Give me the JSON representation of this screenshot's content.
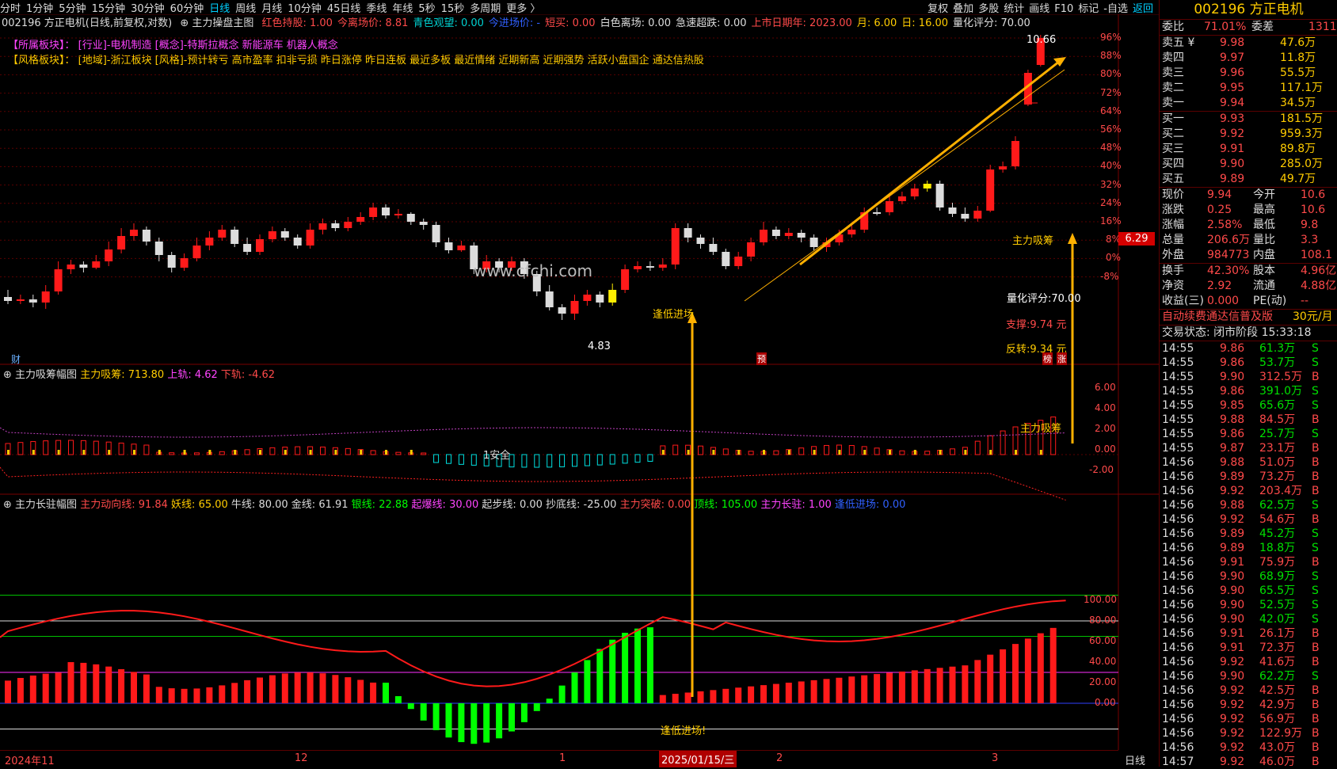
{
  "periods": [
    "分时",
    "1分钟",
    "5分钟",
    "15分钟",
    "30分钟",
    "60分钟",
    "日线",
    "周线",
    "月线",
    "10分钟",
    "45日线",
    "季线",
    "年线",
    "5秒",
    "15秒",
    "多周期",
    "更多 〉"
  ],
  "active_period": "日线",
  "tools": [
    "复权",
    "叠加",
    "多股",
    "统计",
    "画线",
    "F10",
    "标记",
    "-自选",
    "返回"
  ],
  "info": {
    "title": "002196 方正电机(日线,前复权,对数)",
    "indicator": "主力操盘主图",
    "items": [
      {
        "label": "红色持股: 1.00",
        "color": "#ff4a4a"
      },
      {
        "label": "今离场价: 8.81",
        "color": "#ff4a4a"
      },
      {
        "label": "青色观望: 0.00",
        "color": "#00d0d0"
      },
      {
        "label": "今进场价: -",
        "color": "#3060ff"
      },
      {
        "label": "短买: 0.00",
        "color": "#ff4a4a"
      },
      {
        "label": "白色离场: 0.00",
        "color": "#dddddd"
      },
      {
        "label": "急速超跌: 0.00",
        "color": "#dddddd"
      },
      {
        "label": "上市日期年: 2023.00",
        "color": "#ff4a4a"
      },
      {
        "label": "月: 6.00",
        "color": "#ffcc00"
      },
      {
        "label": "日: 16.00",
        "color": "#ffcc00"
      },
      {
        "label": "量化评分: 70.00",
        "color": "#dddddd"
      }
    ]
  },
  "sector": {
    "label1": "【所属板块】：",
    "value1": "[行业]-电机制造 [概念]-特斯拉概念 新能源车 机器人概念",
    "label2": "【风格板块】：",
    "value2": "[地域]-浙江板块 [风格]-预计转亏 高市盈率 扣非亏损 昨日涨停 昨日连板 最近多板 最近情绪 近期新高 近期强势 活跃小盘国企 通达信热股"
  },
  "main_axis": [
    "96%",
    "88%",
    "80%",
    "72%",
    "64%",
    "56%",
    "48%",
    "40%",
    "32%",
    "24%",
    "16%",
    "8%",
    "0%",
    "-8%"
  ],
  "price_tag": "6.29",
  "annotations": {
    "high": "10.66",
    "low": "4.83",
    "entry": "逢低进场",
    "accum": "主力吸筹",
    "score": "量化评分:70.00",
    "support": "支撑:9.74 元",
    "reverse": "反转:9.34 元",
    "watermark": "www.cfchi.com",
    "cai": "财",
    "yu": "预",
    "bang": "榜",
    "zhang": "涨"
  },
  "panel2": {
    "title": "主力吸筹幅图",
    "items": [
      {
        "label": "主力吸筹: 713.80",
        "color": "#ffcc00"
      },
      {
        "label": "上轨: 4.62",
        "color": "#ff44ff"
      },
      {
        "label": "下轨: -4.62",
        "color": "#ff4a4a"
      }
    ],
    "axis": [
      "6.00",
      "4.00",
      "2.00",
      "0.00",
      "-2.00"
    ],
    "safe": "1安全",
    "mark": "主力吸筹"
  },
  "panel3": {
    "title": "主力长驻幅图",
    "items": [
      {
        "label": "主力动向线: 91.84",
        "color": "#ff4a4a"
      },
      {
        "label": "妖线: 65.00",
        "color": "#ffcc00"
      },
      {
        "label": "牛线: 80.00",
        "color": "#dddddd"
      },
      {
        "label": "金线: 61.91",
        "color": "#dddddd"
      },
      {
        "label": "银线: 22.88",
        "color": "#00ff00"
      },
      {
        "label": "起爆线: 30.00",
        "color": "#ff44ff"
      },
      {
        "label": "起步线: 0.00",
        "color": "#dddddd"
      },
      {
        "label": "抄底线: -25.00",
        "color": "#dddddd"
      },
      {
        "label": "主力突破: 0.00",
        "color": "#ff4a4a"
      },
      {
        "label": "顶线: 105.00",
        "color": "#00ff00"
      },
      {
        "label": "主力长驻: 1.00",
        "color": "#ff44ff"
      },
      {
        "label": "逢低进场: 0.00",
        "color": "#3060ff"
      }
    ],
    "axis": [
      "100.00",
      "80.00",
      "60.00",
      "40.00",
      "20.00",
      "0.00"
    ],
    "mark": "逢低进场!"
  },
  "bottom": {
    "dates": [
      "2024年11",
      "12",
      "1",
      "2025/01/15/三",
      "2",
      "3"
    ],
    "cycle": "日线"
  },
  "quote": {
    "title": "002196 方正电机",
    "ratio": {
      "l1": "委比",
      "v1": "71.01%",
      "l2": "委差",
      "v2": "1311"
    },
    "sells": [
      {
        "name": "卖五 ¥",
        "price": "9.98",
        "vol": "47.6万"
      },
      {
        "name": "卖四",
        "price": "9.97",
        "vol": "11.8万"
      },
      {
        "name": "卖三",
        "price": "9.96",
        "vol": "55.5万"
      },
      {
        "name": "卖二",
        "price": "9.95",
        "vol": "117.1万"
      },
      {
        "name": "卖一",
        "price": "9.94",
        "vol": "34.5万"
      }
    ],
    "buys": [
      {
        "name": "买一",
        "price": "9.93",
        "vol": "181.5万"
      },
      {
        "name": "买二",
        "price": "9.92",
        "vol": "959.3万"
      },
      {
        "name": "买三",
        "price": "9.91",
        "vol": "89.8万"
      },
      {
        "name": "买四",
        "price": "9.90",
        "vol": "285.0万"
      },
      {
        "name": "买五",
        "price": "9.89",
        "vol": "49.7万"
      }
    ],
    "stats": [
      {
        "l1": "现价",
        "v1": "9.94",
        "l2": "今开",
        "v2": "10.6"
      },
      {
        "l1": "涨跌",
        "v1": "0.25",
        "l2": "最高",
        "v2": "10.6"
      },
      {
        "l1": "涨幅",
        "v1": "2.58%",
        "l2": "最低",
        "v2": "9.8"
      },
      {
        "l1": "总量",
        "v1": "206.6万",
        "l2": "量比",
        "v2": "3.3"
      },
      {
        "l1": "外盘",
        "v1": "984773",
        "l2": "内盘",
        "v2": "108.1"
      }
    ],
    "stats2": [
      {
        "l1": "换手",
        "v1": "42.30%",
        "l2": "股本",
        "v2": "4.96亿"
      },
      {
        "l1": "净资",
        "v1": "2.92",
        "l2": "流通",
        "v2": "4.88亿"
      },
      {
        "l1": "收益(三)",
        "v1": "0.000",
        "l2": "PE(动)",
        "v2": "--"
      }
    ],
    "ad": "自动续费通达信普及版",
    "ad_price": "30元/月",
    "status": "交易状态: 闭市阶段 15:33:18",
    "ticks": [
      [
        "14:55",
        "9.86",
        "61.3万",
        "S"
      ],
      [
        "14:55",
        "9.86",
        "53.7万",
        "S"
      ],
      [
        "14:55",
        "9.90",
        "312.5万",
        "B"
      ],
      [
        "14:55",
        "9.86",
        "391.0万",
        "S"
      ],
      [
        "14:55",
        "9.85",
        "65.6万",
        "S"
      ],
      [
        "14:55",
        "9.88",
        "84.5万",
        "B"
      ],
      [
        "14:55",
        "9.86",
        "25.7万",
        "S"
      ],
      [
        "14:55",
        "9.87",
        "23.1万",
        "B"
      ],
      [
        "14:56",
        "9.88",
        "51.0万",
        "B"
      ],
      [
        "14:56",
        "9.89",
        "73.2万",
        "B"
      ],
      [
        "14:56",
        "9.92",
        "203.4万",
        "B"
      ],
      [
        "14:56",
        "9.88",
        "62.5万",
        "S"
      ],
      [
        "14:56",
        "9.92",
        "54.6万",
        "B"
      ],
      [
        "14:56",
        "9.89",
        "45.2万",
        "S"
      ],
      [
        "14:56",
        "9.89",
        "18.8万",
        "S"
      ],
      [
        "14:56",
        "9.91",
        "75.9万",
        "B"
      ],
      [
        "14:56",
        "9.90",
        "68.9万",
        "S"
      ],
      [
        "14:56",
        "9.90",
        "65.5万",
        "S"
      ],
      [
        "14:56",
        "9.90",
        "52.5万",
        "S"
      ],
      [
        "14:56",
        "9.90",
        "42.0万",
        "S"
      ],
      [
        "14:56",
        "9.91",
        "26.1万",
        "B"
      ],
      [
        "14:56",
        "9.91",
        "72.3万",
        "B"
      ],
      [
        "14:56",
        "9.92",
        "41.6万",
        "B"
      ],
      [
        "14:56",
        "9.90",
        "62.2万",
        "S"
      ],
      [
        "14:56",
        "9.92",
        "42.5万",
        "B"
      ],
      [
        "14:56",
        "9.92",
        "42.9万",
        "B"
      ],
      [
        "14:56",
        "9.92",
        "56.9万",
        "B"
      ],
      [
        "14:56",
        "9.92",
        "122.9万",
        "B"
      ],
      [
        "14:56",
        "9.92",
        "43.0万",
        "B"
      ],
      [
        "14:57",
        "9.92",
        "46.0万",
        "B"
      ]
    ]
  }
}
